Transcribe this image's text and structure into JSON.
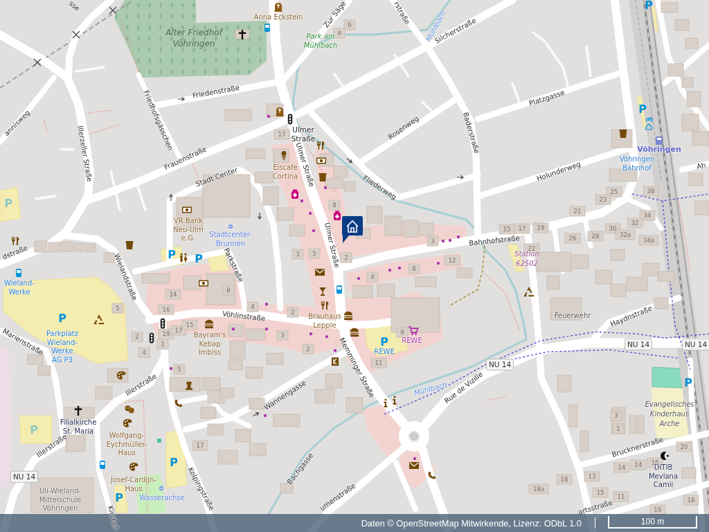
{
  "map": {
    "streets": [
      "sse",
      "Friedenstraße",
      "Friedhofsgässchen",
      "Illerzeller Straße",
      "Frauenstraße",
      "annisweg",
      "Stadt Center",
      "Ulmer Straße",
      "Ulmer Straße",
      "Rosenweg",
      "Fliederweg",
      "Baderstraße",
      "Silcherstraße",
      "rstraße",
      "Zur Säge",
      "Platzgasse",
      "Holunderweg",
      "Bahnhofstraße",
      "Ah",
      "dstraße",
      "Wielandstraße",
      "Parkstraße",
      "Vöhlinstraße",
      "Memminger Straße",
      "Marienstraße",
      "Illerstraße",
      "Illerstraße",
      "Wannengasse",
      "Kolpingstraße",
      "Bachgasse",
      "umenstraße",
      "Rue de Vizille",
      "Haydnstraße",
      "Brucknerstraße",
      "artsstraße",
      "Kirchpl"
    ],
    "places": [
      {
        "lines": [
          "Anna Eckstein"
        ],
        "kind": "amenity"
      },
      {
        "lines": [
          "Alter Friedhof",
          "Vöhringen"
        ],
        "kind": "cemetery"
      },
      {
        "lines": [
          "Park am",
          "Mühlbach"
        ],
        "kind": "park"
      },
      {
        "lines": [
          "Mühlbach"
        ],
        "kind": "water"
      },
      {
        "lines": [
          "Ulmer",
          "Straße"
        ],
        "kind": "stop"
      },
      {
        "lines": [
          "Vöhringen"
        ],
        "kind": "station"
      },
      {
        "lines": [
          "Eiscafe",
          "Cortina"
        ],
        "kind": "amenity"
      },
      {
        "lines": [
          "Vöhringen",
          "Bahnhof"
        ],
        "kind": "transport"
      },
      {
        "lines": [
          "VR Bank",
          "Neu-Ulm",
          "e.G."
        ],
        "kind": "amenity"
      },
      {
        "lines": [
          "Stadtcenter-",
          "Brunnen"
        ],
        "kind": "fountain"
      },
      {
        "lines": [
          "Station",
          "62502"
        ],
        "kind": "substation"
      },
      {
        "lines": [
          "Wieland-",
          "Werke"
        ],
        "kind": "transport"
      },
      {
        "lines": [
          "Brauhaus",
          "Lepple"
        ],
        "kind": "amenity"
      },
      {
        "lines": [
          "Feuerwehr"
        ],
        "kind": "building"
      },
      {
        "lines": [
          "Parkplatz",
          "Wieland-",
          "Werke",
          "AG P3"
        ],
        "kind": "transport"
      },
      {
        "lines": [
          "Bayram's",
          "Kebap",
          "Imbiss"
        ],
        "kind": "amenity"
      },
      {
        "lines": [
          "REWE"
        ],
        "kind": "shop"
      },
      {
        "lines": [
          "REWE"
        ],
        "kind": "transport"
      },
      {
        "lines": [
          "Mühlbach"
        ],
        "kind": "water"
      },
      {
        "lines": [
          "Filialkirche",
          "St. Maria"
        ],
        "kind": "worship"
      },
      {
        "lines": [
          "Evangelisches",
          "Kinderhaus",
          "Arche"
        ],
        "kind": "kindergarten"
      },
      {
        "lines": [
          "Wolfgang-",
          "Eychmüller-",
          "Haus"
        ],
        "kind": "amenity"
      },
      {
        "lines": [
          "Uli-Wieland-",
          "Mittelschule",
          "Vöhringen"
        ],
        "kind": "school"
      },
      {
        "lines": [
          "Josef-Cardijn-",
          "Haus"
        ],
        "kind": "amenity"
      },
      {
        "lines": [
          "DITIB",
          "Mevlana",
          "Camii"
        ],
        "kind": "worship"
      },
      {
        "lines": [
          "Wasserachse"
        ],
        "kind": "fountain"
      }
    ],
    "route_shields": [
      "NU 14",
      "NU 14",
      "NU 14",
      "NU 14"
    ],
    "parking": [
      {
        "text": "P",
        "faded": false
      },
      {
        "text": "P",
        "faded": false
      },
      {
        "text": "P",
        "faded": true
      },
      {
        "text": "P",
        "faded": false
      },
      {
        "text": "P",
        "faded": false
      },
      {
        "text": "P",
        "faded": false
      },
      {
        "text": "P",
        "faded": false
      },
      {
        "text": "P",
        "faded": false
      },
      {
        "text": "P",
        "faded": true
      },
      {
        "text": "P",
        "faded": false
      },
      {
        "text": "P",
        "faded": false
      }
    ],
    "house_numbers": [
      "6",
      "4",
      "17",
      "25",
      "38",
      "23",
      "8",
      "21",
      "34",
      "15",
      "17",
      "19",
      "30",
      "32",
      "3",
      "26",
      "28",
      "32a",
      "34a",
      "3",
      "5",
      "2",
      "12",
      "22",
      "8",
      "4",
      "14",
      "8",
      "5",
      "16",
      "4",
      "2",
      "2",
      "19",
      "17",
      "15",
      "3",
      "9",
      "1",
      "4",
      "2",
      "5",
      "11",
      "3",
      "1",
      "17",
      "20",
      "14",
      "14",
      "16",
      "18",
      "13",
      "18a",
      "15",
      "11",
      "18",
      "16"
    ]
  },
  "attribution": "Daten © OpenStreetMap Mitwirkende, Lizenz: ODbL 1.0",
  "scale_bar": "100 m"
}
